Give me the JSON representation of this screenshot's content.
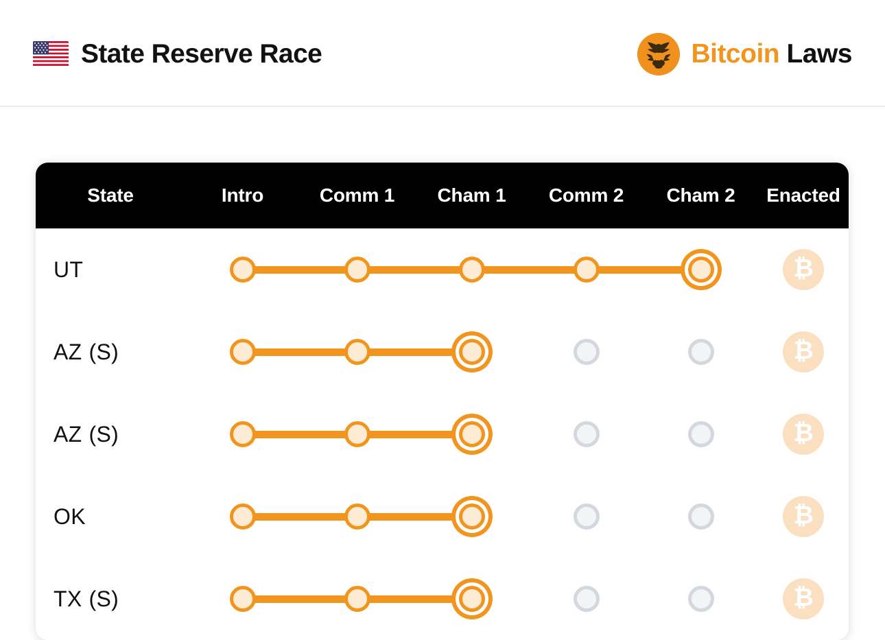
{
  "header": {
    "flag_icon": "us-flag-icon",
    "title": "State Reserve Race",
    "brand": {
      "logo_icon": "eagle-seal-icon",
      "name_primary": "Bitcoin",
      "name_secondary": "Laws",
      "primary_color": "#F2951F",
      "secondary_color": "#111111",
      "logo_color": "#F0911E"
    }
  },
  "table": {
    "columns": [
      "State",
      "Intro",
      "Comm 1",
      "Cham 1",
      "Comm 2",
      "Cham 2",
      "Enacted"
    ],
    "stage_columns": [
      "Intro",
      "Comm 1",
      "Cham 1",
      "Comm 2",
      "Cham 2"
    ],
    "header_background": "#000000",
    "header_text_color": "#FFFFFF",
    "colors": {
      "done": "#F2951F",
      "done_fill": "#FDEBD3",
      "empty_ring": "#D5D7DE",
      "empty_fill": "#F3F4F6",
      "badge_fill": "#FAE0C0",
      "badge_glyph_color": "#FFFFFF"
    },
    "enacted_badge_glyph": "₿",
    "enacted_badge_icon": "bitcoin-badge-icon",
    "rows": [
      {
        "state": "UT",
        "chamber_suffix": "",
        "stages": [
          "done",
          "done",
          "done",
          "done",
          "current"
        ],
        "enacted": true
      },
      {
        "state": "AZ",
        "chamber_suffix": "(S)",
        "stages": [
          "done",
          "done",
          "current",
          "empty",
          "empty"
        ],
        "enacted": true
      },
      {
        "state": "AZ",
        "chamber_suffix": "(S)",
        "stages": [
          "done",
          "done",
          "current",
          "empty",
          "empty"
        ],
        "enacted": true
      },
      {
        "state": "OK",
        "chamber_suffix": "",
        "stages": [
          "done",
          "done",
          "current",
          "empty",
          "empty"
        ],
        "enacted": true
      },
      {
        "state": "TX",
        "chamber_suffix": "(S)",
        "stages": [
          "done",
          "done",
          "current",
          "empty",
          "empty"
        ],
        "enacted": true
      }
    ]
  }
}
